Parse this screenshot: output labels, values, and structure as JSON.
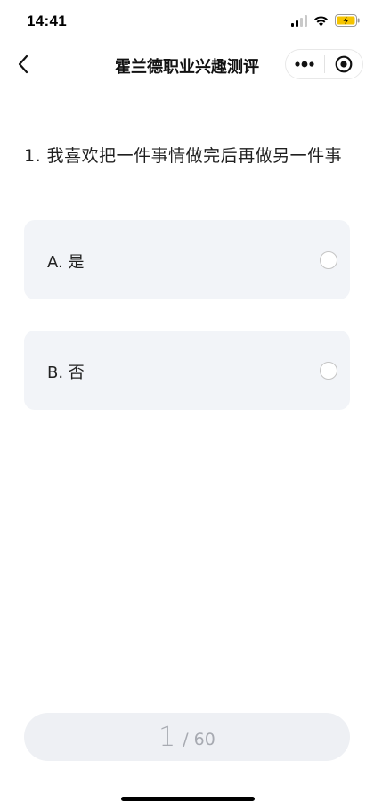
{
  "status_bar": {
    "time": "14:41",
    "icons": [
      "signal-icon",
      "wifi-icon",
      "battery-charging-icon"
    ],
    "battery_color": "#f5c400"
  },
  "nav": {
    "title": "霍兰德职业兴趣测评",
    "back_icon": "chevron-left-icon",
    "menu_icon": "more-dots-icon",
    "close_icon": "target-circle-icon"
  },
  "question": {
    "text": "1. 我喜欢把一件事情做完后再做另一件事"
  },
  "options": [
    {
      "label": "A. 是",
      "selected": false
    },
    {
      "label": "B. 否",
      "selected": false
    }
  ],
  "progress": {
    "current": "1",
    "separator": "/",
    "total": "60"
  },
  "colors": {
    "option_bg": "#f2f4f8",
    "progress_bg": "#eef0f4",
    "progress_text": "#a7aab1"
  }
}
